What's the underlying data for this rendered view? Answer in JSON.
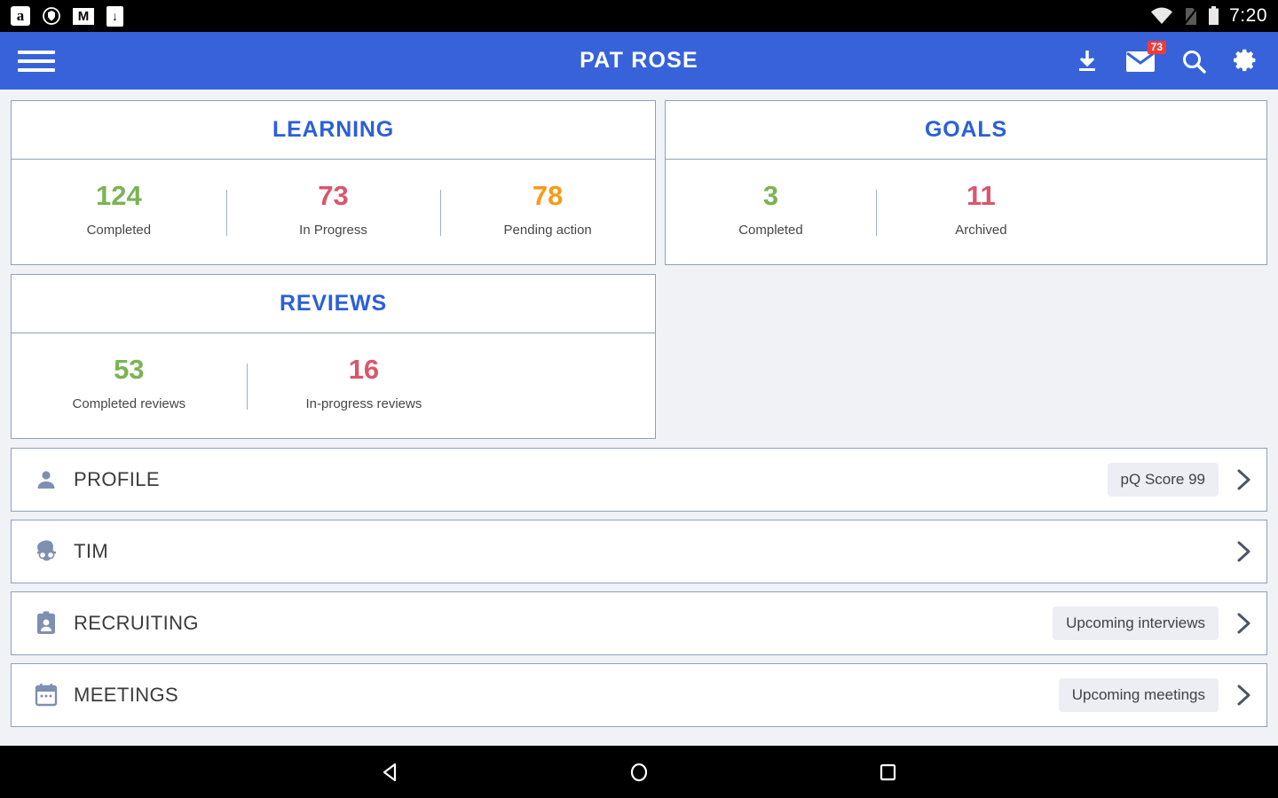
{
  "statusbar": {
    "icons": [
      "amazon-icon",
      "shield-icon",
      "gmail-icon",
      "download-icon"
    ],
    "amazon_glyph": "a",
    "gmail_glyph": "M",
    "download_glyph": "↓",
    "right_icons": [
      "wifi-icon",
      "no-sim-icon",
      "battery-icon"
    ],
    "time": "7:20"
  },
  "appbar": {
    "menu": "menu-icon",
    "title": "PAT ROSE",
    "actions": [
      {
        "name": "download-icon",
        "label": ""
      },
      {
        "name": "mail-icon",
        "label": "",
        "badge": "73"
      },
      {
        "name": "search-icon",
        "label": ""
      },
      {
        "name": "settings-icon",
        "label": ""
      }
    ],
    "accent_color": "#3762d9"
  },
  "cards": [
    {
      "title": "LEARNING",
      "stats": [
        {
          "value": "124",
          "label": "Completed",
          "color": "#7ab454"
        },
        {
          "value": "73",
          "label": "In Progress",
          "color": "#d9566c"
        },
        {
          "value": "78",
          "label": "Pending action",
          "color": "#f99a16"
        }
      ]
    },
    {
      "title": "GOALS",
      "stats": [
        {
          "value": "3",
          "label": "Completed",
          "color": "#7ab454"
        },
        {
          "value": "11",
          "label": "Archived",
          "color": "#d9566c"
        }
      ]
    },
    {
      "title": "REVIEWS",
      "stats": [
        {
          "value": "53",
          "label": "Completed reviews",
          "color": "#7ab454"
        },
        {
          "value": "16",
          "label": "In-progress reviews",
          "color": "#d9566c"
        }
      ]
    }
  ],
  "list": [
    {
      "icon": "person-icon",
      "label": "PROFILE",
      "tag": "pQ Score 99"
    },
    {
      "icon": "tim-avatar-icon",
      "label": "TIM",
      "tag": ""
    },
    {
      "icon": "badge-id-icon",
      "label": "RECRUITING",
      "tag": "Upcoming interviews"
    },
    {
      "icon": "calendar-icon",
      "label": "MEETINGS",
      "tag": "Upcoming meetings"
    }
  ],
  "navbar": {
    "back": "back-icon",
    "home": "home-icon",
    "recents": "recents-icon"
  }
}
